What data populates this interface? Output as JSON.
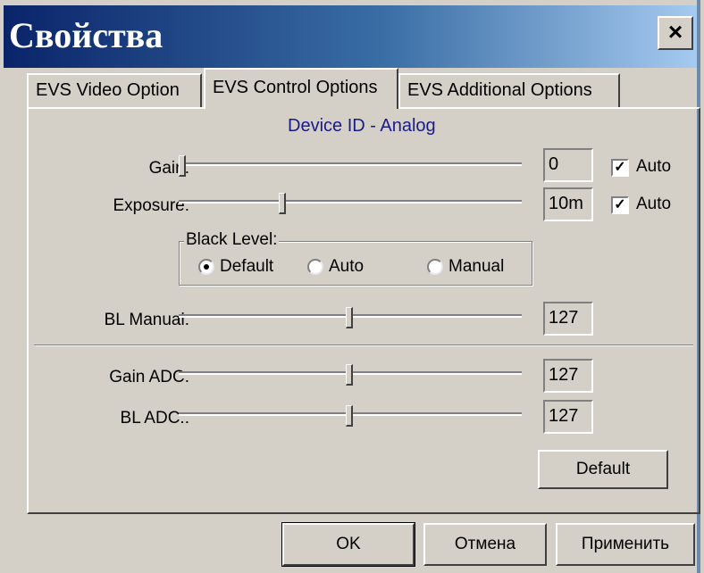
{
  "window": {
    "title": "Свойства",
    "close_label": "×"
  },
  "tabs": [
    {
      "label": "EVS Video Option"
    },
    {
      "label": "EVS Control Options"
    },
    {
      "label": "EVS Additional Options"
    }
  ],
  "panel": {
    "device_id": "Device ID - Analog",
    "gain": {
      "label": "Gain:",
      "value": "0",
      "auto_label": "Auto",
      "auto_checked": true,
      "slider_fraction": 0.0
    },
    "exposure": {
      "label": "Exposure:",
      "value": "10m",
      "auto_label": "Auto",
      "auto_checked": true,
      "slider_fraction": 0.3
    },
    "black_level": {
      "legend": "Black Level:",
      "options": [
        "Default",
        "Auto",
        "Manual"
      ],
      "selected": "Default"
    },
    "bl_manual": {
      "label": "BL Manual:",
      "value": "127",
      "slider_fraction": 0.5
    },
    "gain_adc": {
      "label": "Gain ADC:",
      "value": "127",
      "slider_fraction": 0.5
    },
    "bl_adc": {
      "label": "BL ADC::",
      "value": "127",
      "slider_fraction": 0.5
    },
    "default_button": "Default"
  },
  "footer": {
    "ok": "OK",
    "cancel": "Отмена",
    "apply": "Применить"
  }
}
